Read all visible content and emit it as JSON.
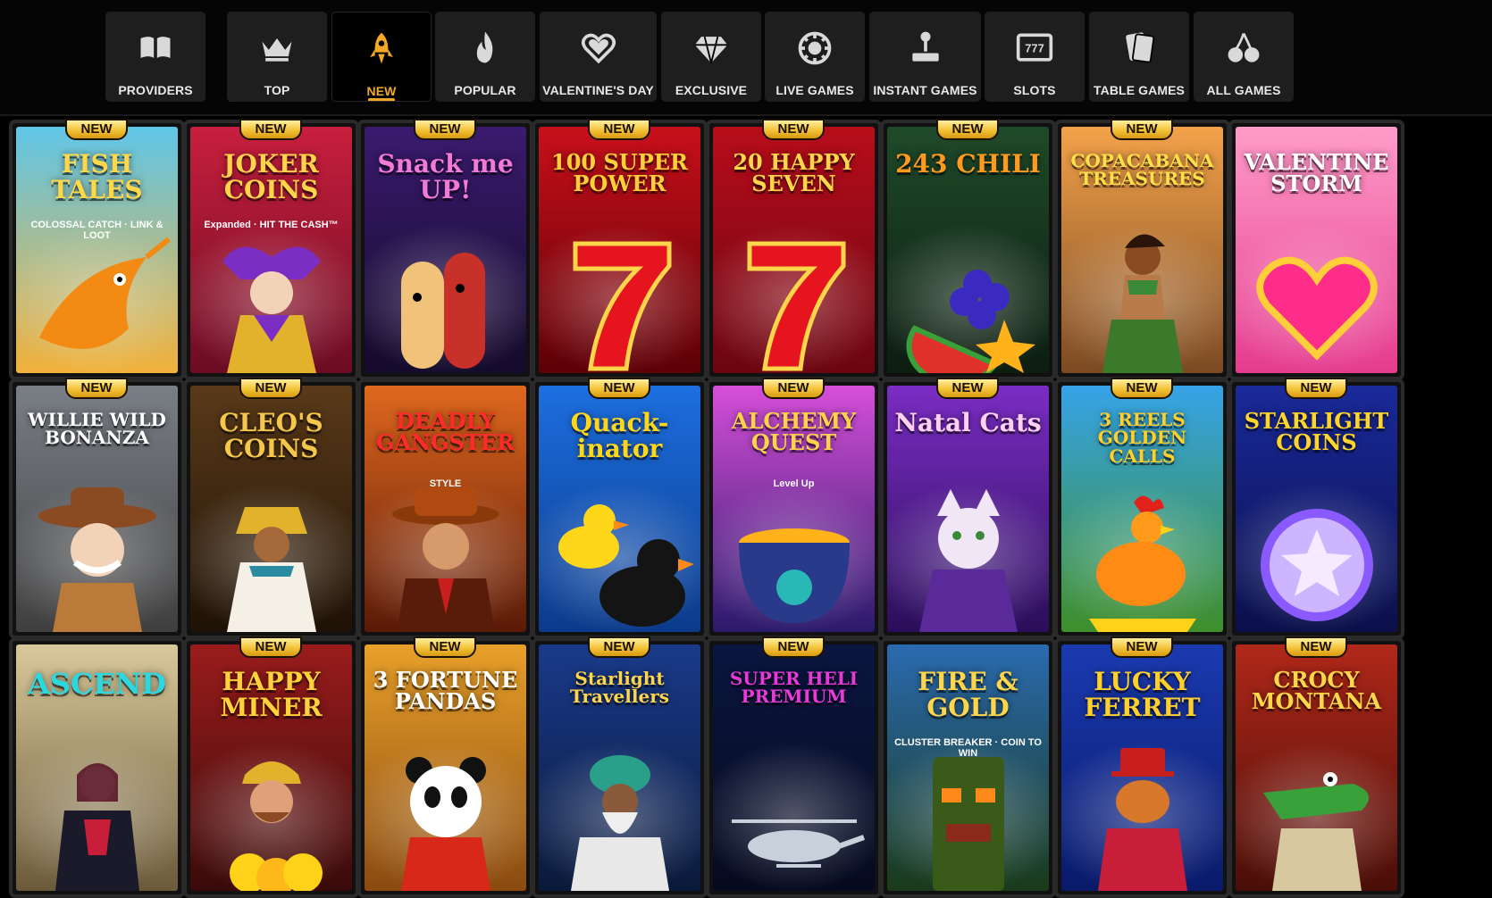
{
  "nav": {
    "tabs": [
      {
        "label": "PROVIDERS",
        "icon": "book-icon",
        "active": false
      },
      {
        "label": "TOP",
        "icon": "crown-icon",
        "active": false
      },
      {
        "label": "NEW",
        "icon": "rocket-icon",
        "active": true
      },
      {
        "label": "POPULAR",
        "icon": "flame-icon",
        "active": false
      },
      {
        "label": "VALENTINE'S DAY",
        "icon": "heart-icon",
        "active": false
      },
      {
        "label": "EXCLUSIVE",
        "icon": "diamond-icon",
        "active": false
      },
      {
        "label": "LIVE GAMES",
        "icon": "chip-icon",
        "active": false
      },
      {
        "label": "INSTANT GAMES",
        "icon": "joystick-icon",
        "active": false
      },
      {
        "label": "SLOTS",
        "icon": "slot-machine-icon",
        "active": false
      },
      {
        "label": "TABLE GAMES",
        "icon": "cards-icon",
        "active": false
      },
      {
        "label": "ALL GAMES",
        "icon": "cherries-icon",
        "active": false
      }
    ],
    "accent_color": "#f2a928"
  },
  "badge_label": "NEW",
  "games": [
    {
      "title": "FISH TALES",
      "sub": "COLOSSAL CATCH · LINK & LOOT",
      "new": true,
      "bg1": "#5fc6e8",
      "bg2": "#f2b13a",
      "ink": "#ffd84a",
      "figure": "fish"
    },
    {
      "title": "JOKER COINS",
      "sub": "Expanded · HIT THE CASH™",
      "new": true,
      "bg1": "#c81f3e",
      "bg2": "#6b0c22",
      "ink": "#ffd34a",
      "figure": "jester"
    },
    {
      "title": "Snack me UP!",
      "sub": "",
      "new": true,
      "bg1": "#3a1b6e",
      "bg2": "#140a2a",
      "ink": "#f27ad8",
      "figure": "sausage"
    },
    {
      "title": "100 SUPER POWER",
      "sub": "",
      "new": true,
      "bg1": "#c8101a",
      "bg2": "#5c0006",
      "ink": "#ffcf3a",
      "figure": "seven"
    },
    {
      "title": "20 HAPPY SEVEN",
      "sub": "",
      "new": true,
      "bg1": "#b80d1b",
      "bg2": "#6a0510",
      "ink": "#ffd54a",
      "figure": "seven"
    },
    {
      "title": "243 CHILI",
      "sub": "",
      "new": true,
      "bg1": "#1f4a2a",
      "bg2": "#0d1d10",
      "ink": "#ff9a1f",
      "figure": "fruit"
    },
    {
      "title": "COPACABANA TREASURES",
      "sub": "",
      "new": true,
      "bg1": "#f3a24a",
      "bg2": "#7b4a23",
      "ink": "#ffe04a",
      "figure": "dancer"
    },
    {
      "title": "VALENTINE STORM",
      "sub": "",
      "new": false,
      "bg1": "#ff9cc9",
      "bg2": "#e53b8e",
      "ink": "#ffffff",
      "figure": "heart"
    },
    {
      "title": "WILLIE WILD BONANZA",
      "sub": "",
      "new": true,
      "bg1": "#7a7f86",
      "bg2": "#3f3f3f",
      "ink": "#ffffff",
      "figure": "cowboy"
    },
    {
      "title": "CLEO'S COINS",
      "sub": "",
      "new": true,
      "bg1": "#5a3a1a",
      "bg2": "#1e1206",
      "ink": "#f4c64a",
      "figure": "queen"
    },
    {
      "title": "DEADLY GANGSTER",
      "sub": "STYLE",
      "new": false,
      "bg1": "#e0681e",
      "bg2": "#5a1a08",
      "ink": "#ff2a2a",
      "figure": "gangster"
    },
    {
      "title": "Quack-inator",
      "sub": "",
      "new": true,
      "bg1": "#1d6fe0",
      "bg2": "#0b3a8a",
      "ink": "#ffd71a",
      "figure": "duck"
    },
    {
      "title": "ALCHEMY QUEST",
      "sub": "Level Up",
      "new": true,
      "bg1": "#d64fd9",
      "bg2": "#2a1a6a",
      "ink": "#ffd24a",
      "figure": "cauldron"
    },
    {
      "title": "Natal Cats",
      "sub": "",
      "new": true,
      "bg1": "#7b2dc4",
      "bg2": "#2a0e5a",
      "ink": "#ffd0f0",
      "figure": "cat"
    },
    {
      "title": "3 REELS GOLDEN CALLS",
      "sub": "",
      "new": true,
      "bg1": "#36a3e8",
      "bg2": "#3f8f2a",
      "ink": "#ffcf2a",
      "figure": "rooster"
    },
    {
      "title": "STARLIGHT COINS",
      "sub": "",
      "new": true,
      "bg1": "#1a2a9a",
      "bg2": "#0b0f4a",
      "ink": "#ffd52a",
      "figure": "coin"
    },
    {
      "title": "ASCEND",
      "sub": "",
      "new": false,
      "bg1": "#d8c89a",
      "bg2": "#6a5a3a",
      "ink": "#2ad8e0",
      "figure": "warrior"
    },
    {
      "title": "HAPPY MINER",
      "sub": "",
      "new": true,
      "bg1": "#9a1c1c",
      "bg2": "#3a0a0a",
      "ink": "#ffd13a",
      "figure": "miner"
    },
    {
      "title": "3 FORTUNE PANDAS",
      "sub": "",
      "new": true,
      "bg1": "#e8a02a",
      "bg2": "#8a4a10",
      "ink": "#ffffff",
      "figure": "panda"
    },
    {
      "title": "Starlight Travellers",
      "sub": "",
      "new": true,
      "bg1": "#1a3a8a",
      "bg2": "#0a1a3a",
      "ink": "#ffd54a",
      "figure": "sultan"
    },
    {
      "title": "SUPER HELI PREMIUM",
      "sub": "",
      "new": true,
      "bg1": "#0b1640",
      "bg2": "#050a1e",
      "ink": "#e93ad8",
      "figure": "heli"
    },
    {
      "title": "FIRE & GOLD",
      "sub": "CLUSTER BREAKER · COIN TO WIN",
      "new": false,
      "bg1": "#2a6ab0",
      "bg2": "#1a3a1a",
      "ink": "#ffd54a",
      "figure": "totem"
    },
    {
      "title": "LUCKY FERRET",
      "sub": "",
      "new": true,
      "bg1": "#1a3ab0",
      "bg2": "#0a1a6a",
      "ink": "#ffcf2a",
      "figure": "ferret"
    },
    {
      "title": "CROCY MONTANA",
      "sub": "",
      "new": true,
      "bg1": "#b0281a",
      "bg2": "#4a0e08",
      "ink": "#ffd54a",
      "figure": "croc"
    }
  ]
}
